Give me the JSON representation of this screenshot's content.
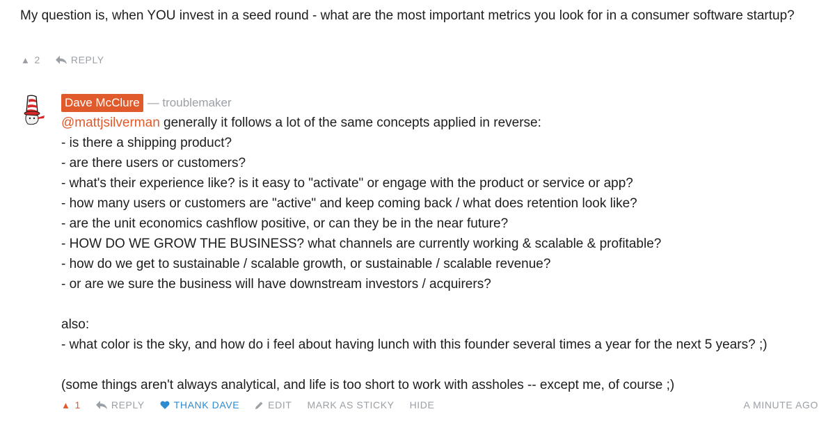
{
  "parent": {
    "text": "My question is, when YOU invest in a seed round - what are the most important metrics you look for in a consumer software startup?",
    "score": "2",
    "reply_label": "REPLY"
  },
  "comment": {
    "author": "Dave McClure",
    "author_tag": "— troublemaker",
    "mention": "@mattjsilverman",
    "first_line": " generally it follows a lot of the same concepts applied in reverse:",
    "lines": [
      "- is there a shipping product?",
      "- are there users or customers?",
      "- what's their experience like? is it easy to \"activate\" or engage with the product or service or app?",
      "- how many users or customers are \"active\" and keep coming back / what does retention look like?",
      "- are the unit economics cashflow positive, or can they be in the near future?",
      "- HOW DO WE GROW THE BUSINESS? what channels are currently working & scalable & profitable?",
      "- how do we get to sustainable / scalable growth, or sustainable / scalable revenue?",
      "- or are we sure the business will have downstream investors / acquirers?"
    ],
    "also_label": "also:",
    "also_line": "- what color is the sky, and how do i feel about having lunch with this founder several times a year for the next 5 years? ;)",
    "closing": "(some things aren't always analytical, and life is too short to work with assholes -- except me, of course ;)",
    "score": "1",
    "actions": {
      "reply": "REPLY",
      "thank": "THANK DAVE",
      "edit": "EDIT",
      "sticky": "MARK AS STICKY",
      "hide": "HIDE"
    },
    "timestamp": "A MINUTE AGO"
  },
  "icons": {
    "upvote": "upvote-arrow-icon",
    "reply": "reply-arrow-icon",
    "heart": "heart-icon",
    "edit": "pencil-icon",
    "avatar": "cat-in-hat-avatar"
  },
  "colors": {
    "accent": "#e05a2b",
    "link_blue": "#2c8bd1",
    "muted": "#9aa0a6",
    "text": "#1d1d1d"
  }
}
